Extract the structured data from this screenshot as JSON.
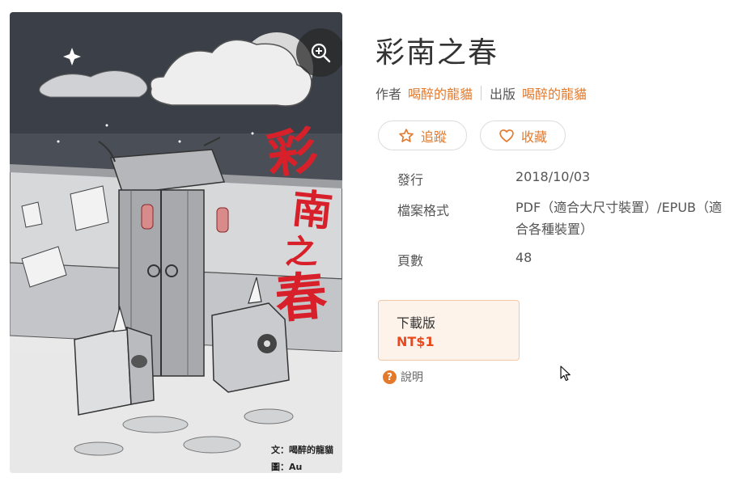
{
  "book": {
    "title": "彩南之春",
    "cover_caption_text": "文：喝醉的龍貓",
    "cover_caption_art": "圖：Au",
    "cover_title_glyphs": "彩南之春"
  },
  "credits": {
    "author_label": "作者",
    "author_name": "喝醉的龍貓",
    "publisher_label": "出版",
    "publisher_name": "喝醉的龍貓"
  },
  "actions": {
    "follow_label": "追蹤",
    "collect_label": "收藏"
  },
  "meta": {
    "release_label": "發行",
    "release_value": "2018/10/03",
    "format_label": "檔案格式",
    "format_value": "PDF（適合大尺寸裝置）/EPUB（適合各種裝置）",
    "pages_label": "頁數",
    "pages_value": "48"
  },
  "price": {
    "label": "下載版",
    "value": "NT$1"
  },
  "help": {
    "icon_glyph": "?",
    "label": "說明"
  },
  "icons": {
    "zoom": "zoom-in-icon",
    "follow": "star-icon",
    "collect": "heart-icon",
    "help": "question-circle-icon"
  },
  "colors": {
    "accent": "#e3792b",
    "price": "#e8491e",
    "price_bg": "#fef3ea"
  }
}
